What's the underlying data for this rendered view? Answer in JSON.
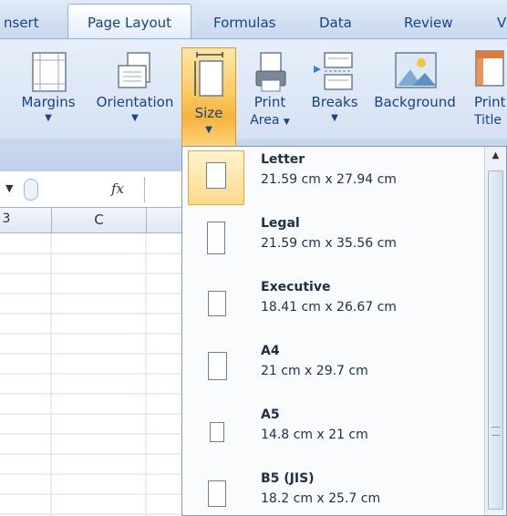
{
  "tabs": [
    {
      "label": "nsert",
      "active": false
    },
    {
      "label": "Page Layout",
      "active": true
    },
    {
      "label": "Formulas",
      "active": false
    },
    {
      "label": "Data",
      "active": false
    },
    {
      "label": "Review",
      "active": false
    },
    {
      "label": "V",
      "active": false
    }
  ],
  "ribbon": {
    "margins": {
      "label": "Margins",
      "icon": "margins-icon"
    },
    "orientation": {
      "label": "Orientation",
      "icon": "orientation-icon"
    },
    "size": {
      "label": "Size",
      "icon": "page-size-icon",
      "active": true
    },
    "print_area": {
      "label": "Print",
      "label2": "Area",
      "icon": "print-area-icon"
    },
    "breaks": {
      "label": "Breaks",
      "icon": "breaks-icon"
    },
    "background": {
      "label": "Background",
      "icon": "background-icon"
    },
    "print_titles": {
      "label": "Print",
      "label2": "Title",
      "icon": "print-titles-icon"
    }
  },
  "formula_bar": {
    "fx": "fx"
  },
  "columns": {
    "c": "C",
    "b": "3"
  },
  "size_menu": {
    "items": [
      {
        "name": "Letter",
        "dims": "21.59 cm x 27.94 cm",
        "selected": true
      },
      {
        "name": "Legal",
        "dims": "21.59 cm x 35.56 cm",
        "selected": false
      },
      {
        "name": "Executive",
        "dims": "18.41 cm x 26.67 cm",
        "selected": false
      },
      {
        "name": "A4",
        "dims": "21 cm x 29.7 cm",
        "selected": false
      },
      {
        "name": "A5",
        "dims": "14.8 cm x 21 cm",
        "selected": false
      },
      {
        "name": "B5 (JIS)",
        "dims": "18.2 cm x 25.7 cm",
        "selected": false
      }
    ]
  },
  "colors": {
    "accent": "#fbca62",
    "ribbon_text": "#15428b",
    "border": "#7f9db9"
  }
}
